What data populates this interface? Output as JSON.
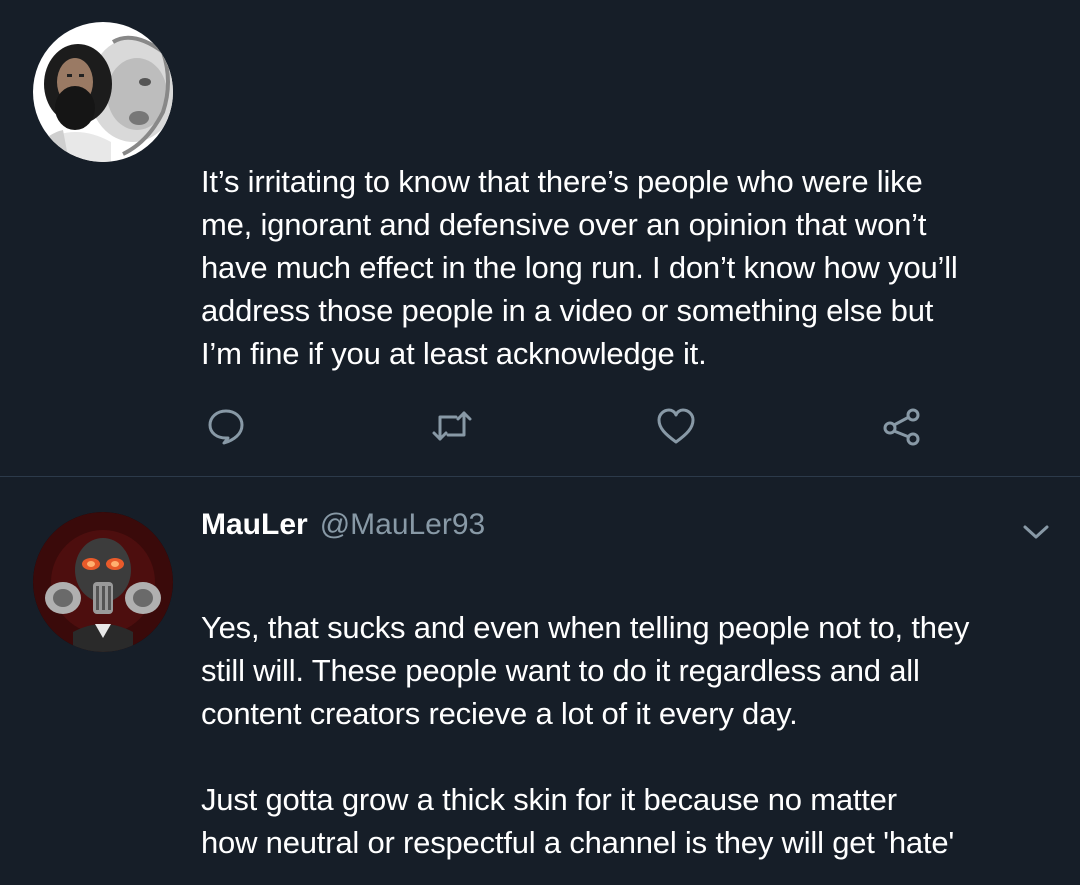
{
  "colors": {
    "background": "#161e28",
    "text": "#ffffff",
    "muted": "#8899a6",
    "icon": "#8899a6",
    "divider": "#2c3a4a"
  },
  "tweets": [
    {
      "avatar": "profile-photo-man-with-lion",
      "text": "It’s irritating to know that there’s people who were like\nme, ignorant and defensive over an opinion that won’t\nhave much effect in the long run. I don’t know how you’ll\naddress those people in a video or something else but\nI’m fine if you at least acknowledge it.",
      "actions": [
        {
          "name": "reply",
          "icon": "reply-icon"
        },
        {
          "name": "retweet",
          "icon": "retweet-icon"
        },
        {
          "name": "like",
          "icon": "heart-icon"
        },
        {
          "name": "share",
          "icon": "share-icon"
        }
      ]
    },
    {
      "avatar": "profile-photo-gas-mask",
      "display_name": "MauLer",
      "handle": "@MauLer93",
      "menu_icon": "chevron-down-icon",
      "text": "Yes, that sucks and even when telling people not to, they\nstill will. These people want to do it regardless and all\ncontent creators recieve a lot of it every day.\n\nJust gotta grow a thick skin for it because no matter\nhow neutral or respectful a channel is they will get 'hate'"
    }
  ]
}
